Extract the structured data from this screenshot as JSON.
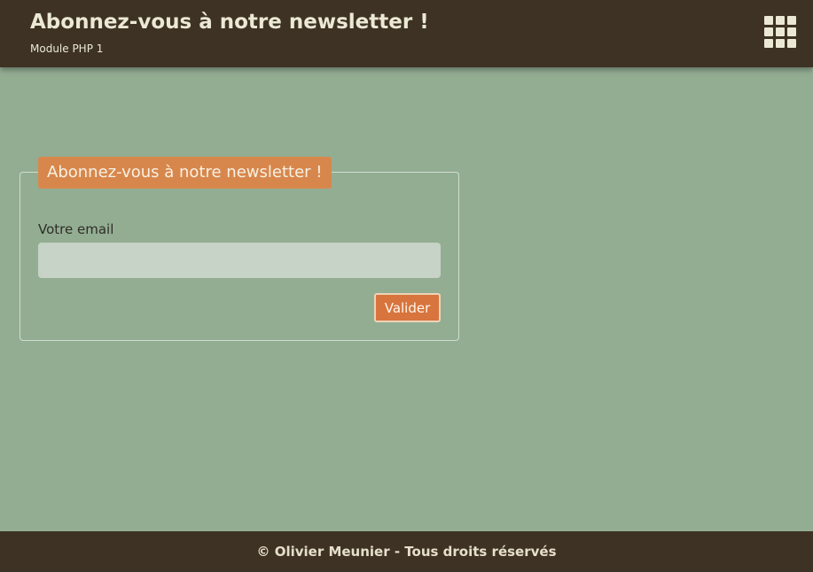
{
  "header": {
    "title": "Abonnez-vous à notre newsletter !",
    "subtitle": "Module PHP 1",
    "menu_icon": "grid-menu-icon"
  },
  "form": {
    "legend": "Abonnez-vous à notre newsletter !",
    "email_label": "Votre email",
    "email_value": "",
    "email_placeholder": "",
    "submit_label": "Valider"
  },
  "footer": {
    "text": "© Olivier Meunier - Tous droits réservés"
  },
  "colors": {
    "page_background": "#93ad93",
    "header_footer": "#3d3223",
    "legend": "#d8874c",
    "button": "#d8743d",
    "input": "#c6d3c6",
    "light_text": "#ece8d6"
  }
}
